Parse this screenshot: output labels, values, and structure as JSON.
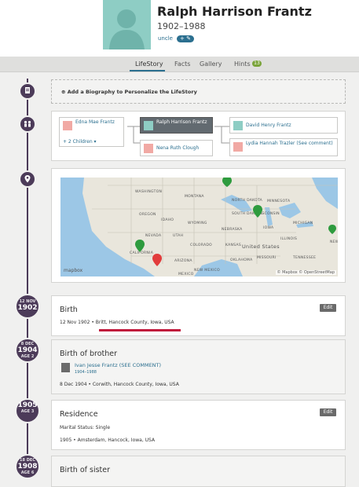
{
  "header": {
    "name": "Ralph Harrison Frantz",
    "dates": "1902–1988",
    "relationship": "uncle",
    "rel_button": "+ ✎"
  },
  "tabs": [
    {
      "label": "LifeStory"
    },
    {
      "label": "Facts"
    },
    {
      "label": "Gallery"
    },
    {
      "label": "Hints"
    }
  ],
  "hints_count": "13",
  "biography": {
    "text": "Add a Biography to Personalize the LifeStory"
  },
  "family": {
    "mother": "Edna Mae Frantz",
    "children_link": "+ 2 Children ▾",
    "self": "Ralph Harrison Frantz",
    "sibling": "Nena Ruth Clough",
    "father": "David Henry Frantz",
    "spouse": "Lydia Hannah Trazler (See comment)"
  },
  "map": {
    "labels": [
      "WASHINGTON",
      "MONTANA",
      "NORTH DAKOTA",
      "MINNESOTA",
      "SOUTH DAKOTA",
      "WISCONSIN",
      "MICHIGAN",
      "OREGON",
      "IDAHO",
      "WYOMING",
      "IOWA",
      "NEBRASKA",
      "NEVADA",
      "UTAH",
      "COLORADO",
      "KANSAS",
      "ILLINOIS",
      "United States",
      "MISSOURI",
      "CALIFORNIA",
      "ARIZONA",
      "NEW MEXICO",
      "OKLAHOMA",
      "TENNESSEE",
      "MEXICO",
      "NEW"
    ],
    "logo": "mapbox",
    "attribution": "© Mapbox  © OpenStreetMap"
  },
  "events": [
    {
      "badge_small": "12 NOV",
      "badge_big": "1902",
      "badge_age": "",
      "title": "Birth",
      "detail": "12 Nov 1902 • Britt, Hancock County, Iowa, USA",
      "edit": "Edit"
    },
    {
      "badge_small": "8 DEC",
      "badge_big": "1904",
      "badge_age": "AGE 2",
      "title": "Birth of brother",
      "person": "Ivan Jesse Frantz (SEE COMMENT)",
      "person_dates": "1904–1988",
      "detail": "8 Dec 1904 • Corwith, Hancock County, Iowa, USA"
    },
    {
      "badge_small": "",
      "badge_big": "1905",
      "badge_age": "AGE 3",
      "title": "Residence",
      "marital": "Marital Status: Single",
      "detail": "1905 • Amsterdam, Hancock, Iowa, USA",
      "edit": "Edit"
    },
    {
      "badge_small": "18 DEC",
      "badge_big": "1908",
      "badge_age": "AGE 6",
      "title": "Birth of sister"
    }
  ],
  "colors": {
    "accent": "#2b6f8f",
    "timeline": "#4c3b59",
    "male": "#8ecdc4",
    "female": "#f1a9a4",
    "underline": "#c0163b",
    "marker": "#2e9b3e"
  }
}
